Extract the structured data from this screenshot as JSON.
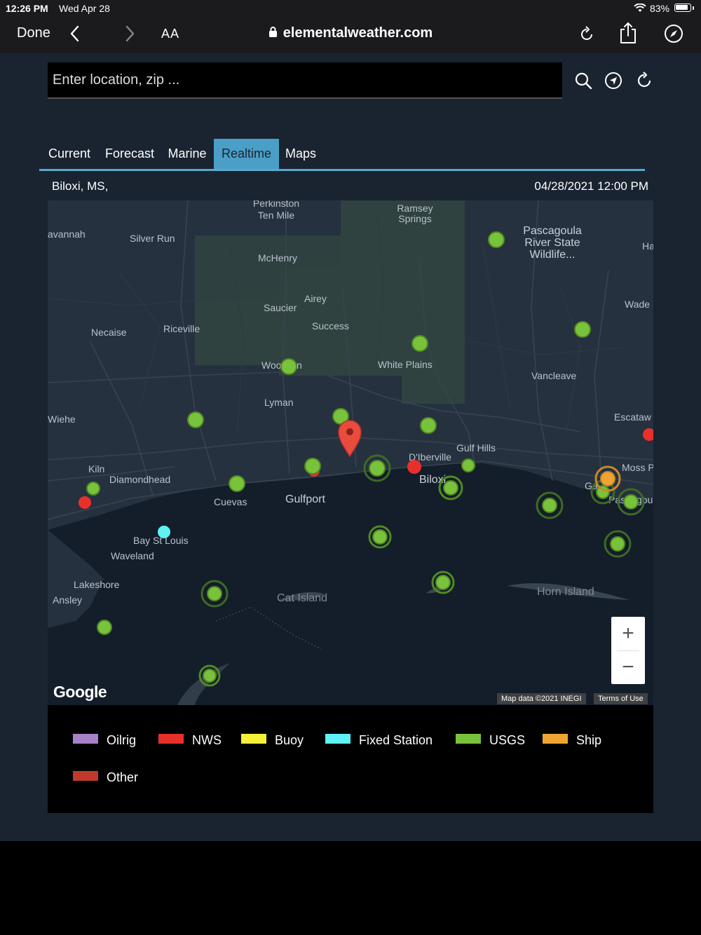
{
  "status_bar": {
    "time": "12:26 PM",
    "date": "Wed Apr 28",
    "battery": "83%"
  },
  "browser": {
    "done_label": "Done",
    "text_size_label": "AA",
    "url": "elementalweather.com"
  },
  "search": {
    "placeholder": "Enter location, zip ..."
  },
  "tabs": [
    {
      "label": "Current",
      "active": false
    },
    {
      "label": "Forecast",
      "active": false
    },
    {
      "label": "Marine",
      "active": false
    },
    {
      "label": "Realtime",
      "active": true
    },
    {
      "label": "Maps",
      "active": false
    }
  ],
  "location": {
    "name": "Biloxi, MS,",
    "datetime": "04/28/2021 12:00 PM"
  },
  "map": {
    "place_labels": [
      "Perkinston",
      "Ten Mile",
      "Ramsey",
      "Springs",
      "Pascagoula",
      "River State",
      "Wildlife...",
      "avannah",
      "Silver Run",
      "McHenry",
      "Airey",
      "Saucier",
      "Success",
      "Necaise",
      "Riceville",
      "Wood",
      "n",
      "White Plains",
      "Vancleave",
      "Wade",
      "Lyman",
      "Wiehe",
      "Escataw",
      "Gulf Hills",
      "D'Iberville",
      "Kiln",
      "Diamondhead",
      "Cuevas",
      "Gulfport",
      "Biloxi",
      "Moss P",
      "Ga",
      "Pas",
      "gou",
      "Ha",
      "Bay St Louis",
      "Waveland",
      "Lakeshore",
      "Ansley",
      "Cat Island",
      "Horn Island"
    ],
    "google_logo": "Google",
    "map_data": "Map data ©2021 INEGI",
    "terms": "Terms of Use",
    "zoom_in": "+",
    "zoom_out": "−"
  },
  "legend": [
    {
      "label": "Oilrig",
      "color": "#a781c9"
    },
    {
      "label": "NWS",
      "color": "#e8302a"
    },
    {
      "label": "Buoy",
      "color": "#f5ef3a"
    },
    {
      "label": "Fixed Station",
      "color": "#5ef2f5"
    },
    {
      "label": "USGS",
      "color": "#79c23b"
    },
    {
      "label": "Ship",
      "color": "#f0a533"
    },
    {
      "label": "Other",
      "color": "#c0392b"
    }
  ],
  "colors": {
    "usgs": "#79c23b",
    "nws": "#e8302a",
    "fixed": "#5ef2f5",
    "ship": "#f0a533",
    "pin": "#e94b3c",
    "accent": "#4a9fc7"
  }
}
